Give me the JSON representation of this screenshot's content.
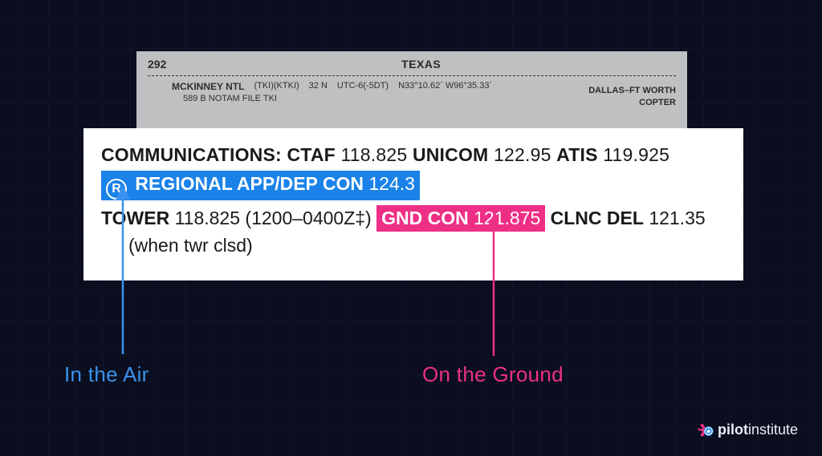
{
  "doc": {
    "page_number": "292",
    "state": "TEXAS",
    "airport_name": "MCKINNEY NTL",
    "idents": "(TKI)(KTKI)",
    "loc": "32 N",
    "utc": "UTC-6(-5DT)",
    "coords": "N33°10.62´ W96°35.33´",
    "line3": "589   B   NOTAM FILE TKI",
    "region": "DALLAS–FT WORTH",
    "copter": "COPTER"
  },
  "comm": {
    "heading": "COMMUNICATIONS:",
    "ctaf_label": "CTAF",
    "ctaf_freq": "118.825",
    "unicom_label": "UNICOM",
    "unicom_freq": "122.95",
    "atis_label": "ATIS",
    "atis_freq": "119.925",
    "registered_mark": "R",
    "appdep_label": "REGIONAL APP/DEP CON",
    "appdep_freq": "124.3",
    "tower_label": "TOWER",
    "tower_freq": "118.825",
    "tower_hours": "(1200–0400Z‡)",
    "gnd_label": "GND CON",
    "gnd_freq": "121.875",
    "clnc_label": "CLNC DEL",
    "clnc_freq": "121.35",
    "note": "(when twr clsd)"
  },
  "callouts": {
    "air": "In the Air",
    "ground": "On the Ground"
  },
  "brand": {
    "name_bold": "pilot",
    "name_light": "institute"
  },
  "colors": {
    "blue": "#1a82e8",
    "pink": "#ee2f86",
    "bg": "#0a0e1f"
  }
}
